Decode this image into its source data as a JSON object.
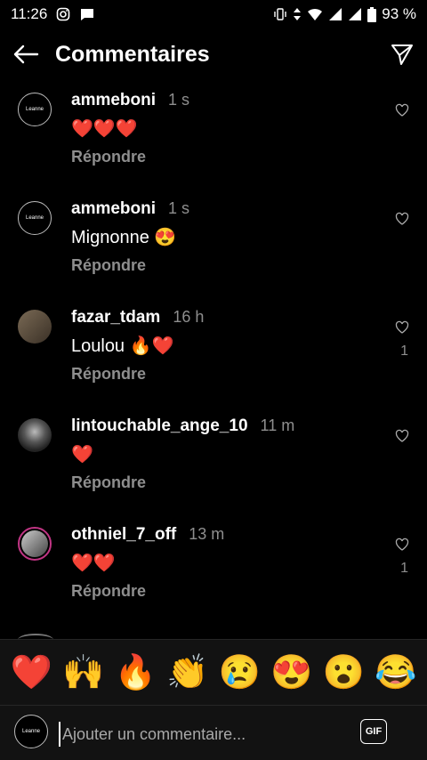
{
  "status": {
    "time": "11:26",
    "battery": "93 %"
  },
  "header": {
    "title": "Commentaires"
  },
  "comments": [
    {
      "username": "ammeboni",
      "time": "1 s",
      "text": "❤️❤️❤️",
      "reply": "Répondre",
      "likes": ""
    },
    {
      "username": "ammeboni",
      "time": "1 s",
      "text": "Mignonne 😍",
      "reply": "Répondre",
      "likes": ""
    },
    {
      "username": "fazar_tdam",
      "time": "16 h",
      "text": "Loulou 🔥❤️",
      "reply": "Répondre",
      "likes": "1"
    },
    {
      "username": "lintouchable_ange_10",
      "time": "11 m",
      "text": "❤️",
      "reply": "Répondre",
      "likes": ""
    },
    {
      "username": "othniel_7_off",
      "time": "13 m",
      "text": "❤️❤️",
      "reply": "Répondre",
      "likes": "1"
    }
  ],
  "emoji_bar": [
    "❤️",
    "🙌",
    "🔥",
    "👏",
    "😢",
    "😍",
    "😮",
    "😂"
  ],
  "composer": {
    "placeholder": "Ajouter un commentaire...",
    "gif_label": "GIF"
  },
  "avatar_text": "Leanne"
}
